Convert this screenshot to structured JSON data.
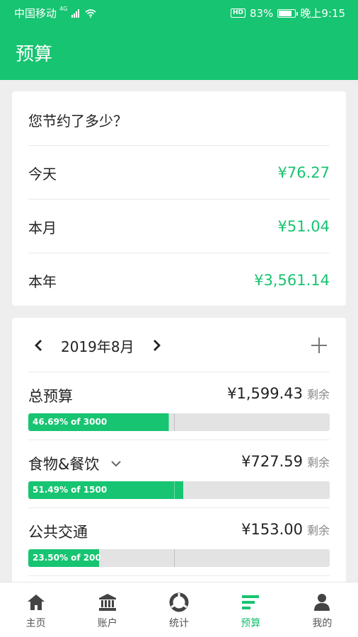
{
  "status_bar": {
    "carrier": "中国移动",
    "network": "4G",
    "hd": "HD",
    "battery": "83%",
    "time": "晚上9:15"
  },
  "app_bar": {
    "title": "预算"
  },
  "savings": {
    "title": "您节约了多少？",
    "rows": [
      {
        "label": "今天",
        "amount": "¥76.27"
      },
      {
        "label": "本月",
        "amount": "¥51.04"
      },
      {
        "label": "本年",
        "amount": "¥3,561.14"
      }
    ]
  },
  "budget": {
    "month": "2019年8月",
    "items": [
      {
        "name": "总预算",
        "remaining": "¥1,599.43",
        "suffix": "剩余",
        "bar_text": "46.69%  of  3000",
        "percent": 46.69,
        "has_dropdown": false
      },
      {
        "name": "食物&餐饮",
        "remaining": "¥727.59",
        "suffix": "剩余",
        "bar_text": "51.49%  of  1500",
        "percent": 51.49,
        "has_dropdown": true
      },
      {
        "name": "公共交通",
        "remaining": "¥153.00",
        "suffix": "剩余",
        "bar_text": "23.50%  of  200",
        "percent": 23.5,
        "has_dropdown": false
      }
    ]
  },
  "tabs": [
    {
      "label": "主页",
      "icon": "home-icon",
      "active": false
    },
    {
      "label": "账户",
      "icon": "bank-icon",
      "active": false
    },
    {
      "label": "统计",
      "icon": "statistics-icon",
      "active": false
    },
    {
      "label": "预算",
      "icon": "budget-icon",
      "active": true
    },
    {
      "label": "我的",
      "icon": "person-icon",
      "active": false
    }
  ],
  "colors": {
    "accent": "#17c471",
    "background": "#eeeeee",
    "bar_track": "#e3e3e3"
  }
}
